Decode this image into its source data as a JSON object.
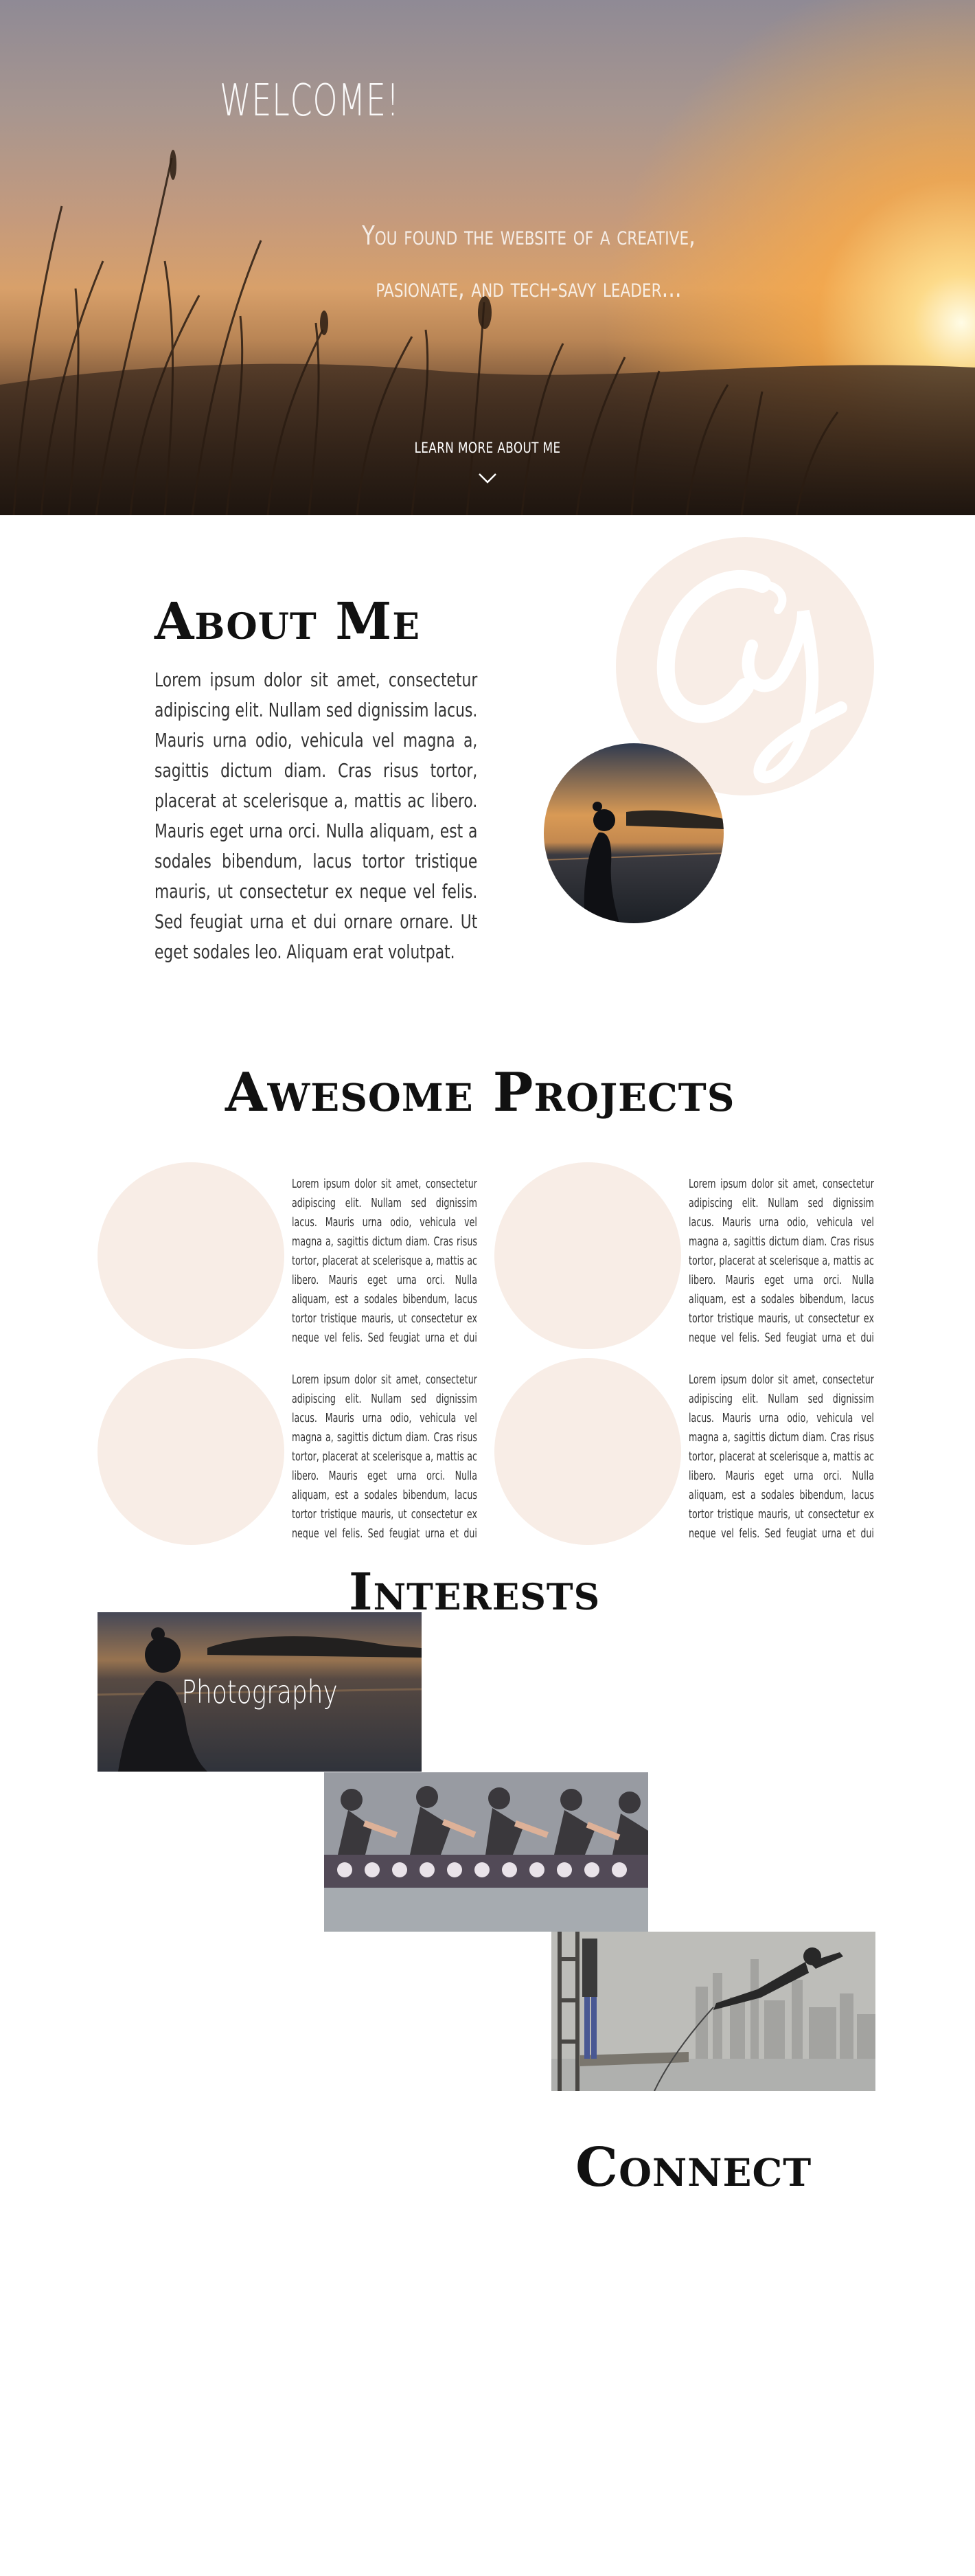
{
  "hero": {
    "title": "WELCOME!",
    "subtitle_line1": "You found the website of a creative,",
    "subtitle_line2": "pasionate, and tech-savy leader...",
    "learn_more": "LEARN MORE ABOUT ME",
    "chevron_icon": "chevron-down-icon"
  },
  "about": {
    "title": "About Me",
    "body": "Lorem ipsum dolor sit amet, consectetur adipiscing elit. Nullam sed dignissim lacus. Mauris urna odio, vehicula vel magna a, sagittis dictum diam. Cras risus tortor, placerat at scelerisque a, mattis ac libero. Mauris eget urna orci. Nulla aliquam, est a sodales bibendum, lacus tortor tristique mauris, ut consectetur ex neque vel felis. Sed feugiat urna et dui ornare ornare. Ut eget sodales leo. Aliquam erat volutpat.",
    "monogram_icon": "cy-monogram-logo",
    "monogram_color": "#f8ede6"
  },
  "projects": {
    "title": "Awesome Projects",
    "circle_color": "#f8ede6",
    "items": [
      {
        "text": "Lorem ipsum dolor sit amet, consectetur adipiscing elit. Nullam sed dignissim lacus. Mauris urna odio, vehicula vel magna a, sagittis dictum diam. Cras risus tortor, placerat at scelerisque a, mattis ac libero. Mauris eget urna orci. Nulla aliquam, est a sodales bibendum, lacus tortor tristique mauris, ut consectetur ex neque vel felis. Sed feugiat urna et dui ornare ornare. Ut"
      },
      {
        "text": "Lorem ipsum dolor sit amet, consectetur adipiscing elit. Nullam sed dignissim lacus. Mauris urna odio, vehicula vel magna a, sagittis dictum diam. Cras risus tortor, placerat at scelerisque a, mattis ac libero. Mauris eget urna orci. Nulla aliquam, est a sodales bibendum, lacus tortor tristique mauris, ut consectetur ex neque vel felis. Sed feugiat urna et dui ornare ornare. Ut"
      },
      {
        "text": "Lorem ipsum dolor sit amet, consectetur adipiscing elit. Nullam sed dignissim lacus. Mauris urna odio, vehicula vel magna a, sagittis dictum diam. Cras risus tortor, placerat at scelerisque a, mattis ac libero. Mauris eget urna orci. Nulla aliquam, est a sodales bibendum, lacus tortor tristique mauris, ut consectetur ex neque vel felis. Sed feugiat urna et dui ornare ornare. Ut"
      },
      {
        "text": "Lorem ipsum dolor sit amet, consectetur adipiscing elit. Nullam sed dignissim lacus. Mauris urna odio, vehicula vel magna a, sagittis dictum diam. Cras risus tortor, placerat at scelerisque a, mattis ac libero. Mauris eget urna orci. Nulla aliquam, est a sodales bibendum, lacus tortor tristique mauris, ut consectetur ex neque vel felis. Sed feugiat urna et dui ornare ornare. Ut"
      }
    ]
  },
  "interests": {
    "title": "Interests",
    "items": [
      {
        "label": "Photography"
      },
      {
        "label": ""
      },
      {
        "label": ""
      }
    ]
  },
  "connect": {
    "title": "Connect"
  }
}
